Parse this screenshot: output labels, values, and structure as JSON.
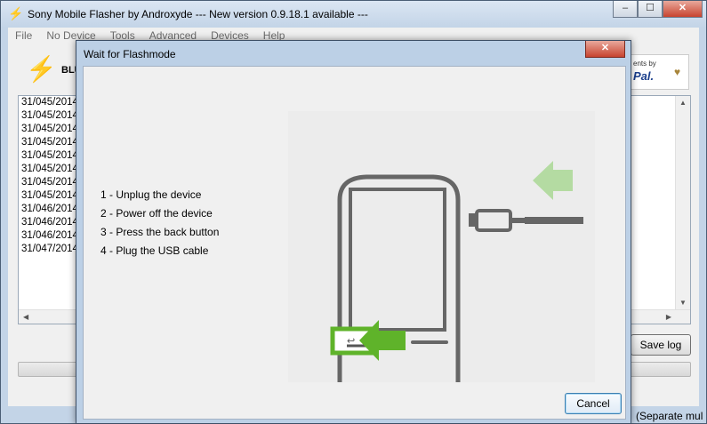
{
  "main_window": {
    "title": "Sony Mobile Flasher by Androxyde     --- New version 0.9.18.1 available ---",
    "title_icon": "lightning-icon",
    "caption_buttons": [
      "–",
      "☐",
      "✕"
    ],
    "menu": [
      "File",
      "No Device",
      "Tools",
      "Advanced",
      "Devices",
      "Help"
    ],
    "toolbar_label": "BLU",
    "paypal": {
      "top": "ents by",
      "word": "Pal.",
      "heart": "♥"
    },
    "log_lines": [
      "31/045/2014",
      "31/045/2014",
      "31/045/2014",
      "31/045/2014",
      "31/045/2014",
      "31/045/2014",
      "31/045/2014",
      "31/045/2014",
      "31/046/2014",
      "31/046/2014",
      "31/046/2014",
      "31/047/2014"
    ],
    "save_log_label": "Save log",
    "status_text": "(Separate mul"
  },
  "dialog": {
    "title": "Wait for Flashmode",
    "close_label": "✕",
    "steps": [
      "1 - Unplug the device",
      "2 - Power off the device",
      "3 - Press the back button",
      "4 - Plug the USB cable"
    ],
    "cancel_label": "Cancel"
  },
  "colors": {
    "arrow_green": "#5fb32a",
    "arrow_light": "#b4dba2",
    "phone_outline": "#666666"
  }
}
